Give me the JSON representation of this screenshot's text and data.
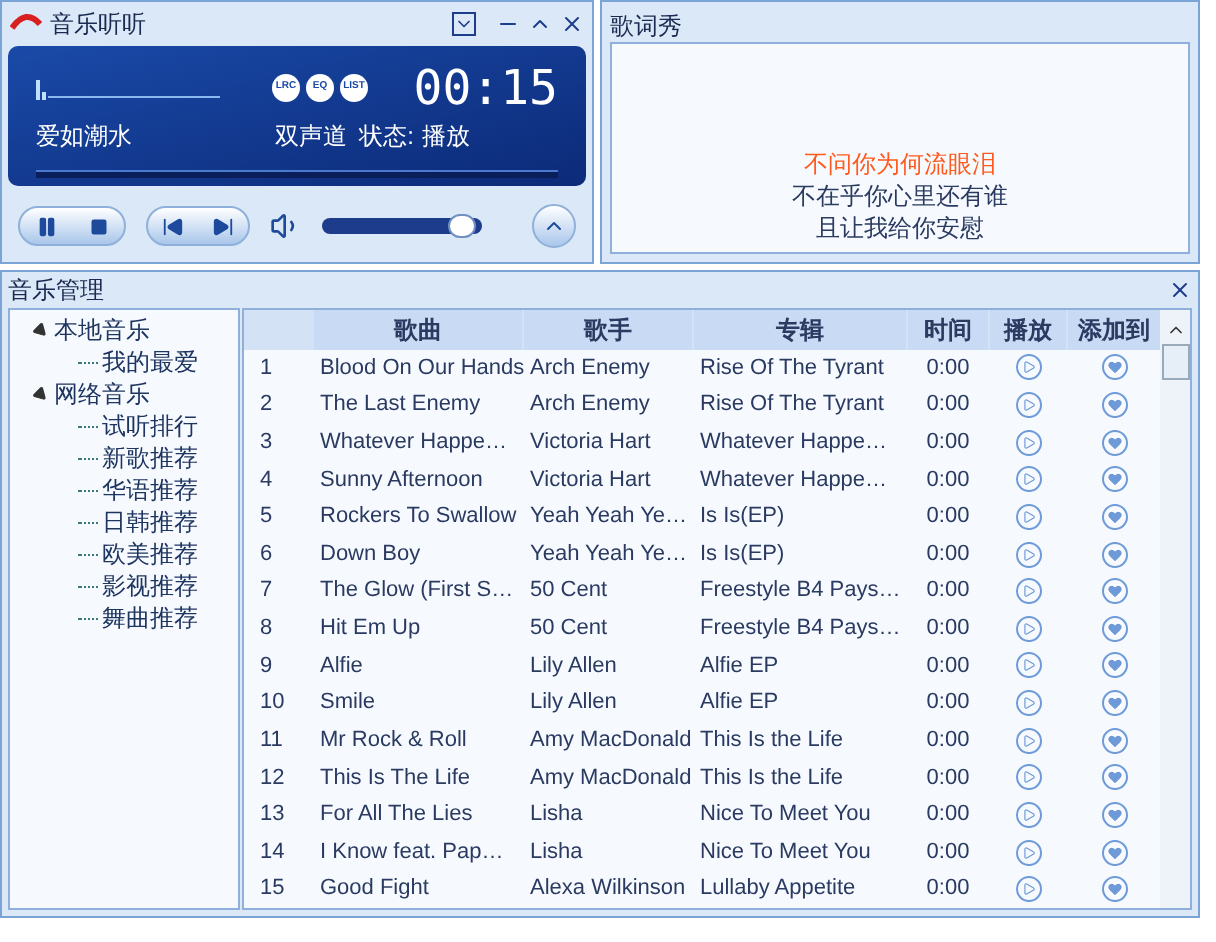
{
  "player": {
    "title": "音乐听听",
    "time": "00:15",
    "song": "爱如潮水",
    "channel": "双声道",
    "status_label": "状态:",
    "status": "播放",
    "volume": {
      "level": 0.88
    },
    "mode_buttons": [
      "LRC",
      "EQ",
      "LIST"
    ]
  },
  "lyrics": {
    "title": "歌词秀",
    "lines": [
      {
        "text": "不问你为何流眼泪",
        "current": true
      },
      {
        "text": "不在乎你心里还有谁",
        "current": false
      },
      {
        "text": "且让我给你安慰",
        "current": false
      }
    ]
  },
  "library": {
    "title": "音乐管理",
    "tree": [
      {
        "label": "本地音乐",
        "expanded": true,
        "children": [
          {
            "label": "我的最爱"
          }
        ]
      },
      {
        "label": "网络音乐",
        "expanded": true,
        "children": [
          {
            "label": "试听排行"
          },
          {
            "label": "新歌推荐"
          },
          {
            "label": "华语推荐"
          },
          {
            "label": "日韩推荐"
          },
          {
            "label": "欧美推荐"
          },
          {
            "label": "影视推荐"
          },
          {
            "label": "舞曲推荐"
          }
        ]
      }
    ],
    "table": {
      "columns": [
        "",
        "歌曲",
        "歌手",
        "专辑",
        "时间",
        "播放",
        "添加到"
      ],
      "rows": [
        [
          "1",
          "Blood On Our Hands",
          "Arch Enemy",
          "Rise Of The Tyrant",
          "0:00"
        ],
        [
          "2",
          "The Last Enemy",
          "Arch Enemy",
          "Rise Of The Tyrant",
          "0:00"
        ],
        [
          "3",
          "Whatever Happe…",
          "Victoria Hart",
          "Whatever Happe…",
          "0:00"
        ],
        [
          "4",
          "Sunny Afternoon",
          "Victoria Hart",
          "Whatever Happe…",
          "0:00"
        ],
        [
          "5",
          "Rockers To Swallow",
          "Yeah Yeah Ye…",
          "Is Is(EP)",
          "0:00"
        ],
        [
          "6",
          "Down Boy",
          "Yeah Yeah Ye…",
          "Is Is(EP)",
          "0:00"
        ],
        [
          "7",
          "The Glow (First S…",
          "50 Cent",
          "Freestyle B4 Pays…",
          "0:00"
        ],
        [
          "8",
          "Hit Em Up",
          "50 Cent",
          "Freestyle B4 Pays…",
          "0:00"
        ],
        [
          "9",
          "Alfie",
          "Lily Allen",
          "Alfie EP",
          "0:00"
        ],
        [
          "10",
          "Smile",
          "Lily Allen",
          "Alfie EP",
          "0:00"
        ],
        [
          "11",
          "Mr Rock & Roll",
          "Amy MacDonald",
          "This Is the Life",
          "0:00"
        ],
        [
          "12",
          "This Is The Life",
          "Amy MacDonald",
          "This Is the Life",
          "0:00"
        ],
        [
          "13",
          "For All The Lies",
          "Lisha",
          "Nice To Meet You",
          "0:00"
        ],
        [
          "14",
          "I Know feat. Pap…",
          "Lisha",
          "Nice To Meet You",
          "0:00"
        ],
        [
          "15",
          "Good Fight",
          "Alexa Wilkinson",
          "Lullaby Appetite",
          "0:00"
        ]
      ]
    }
  }
}
